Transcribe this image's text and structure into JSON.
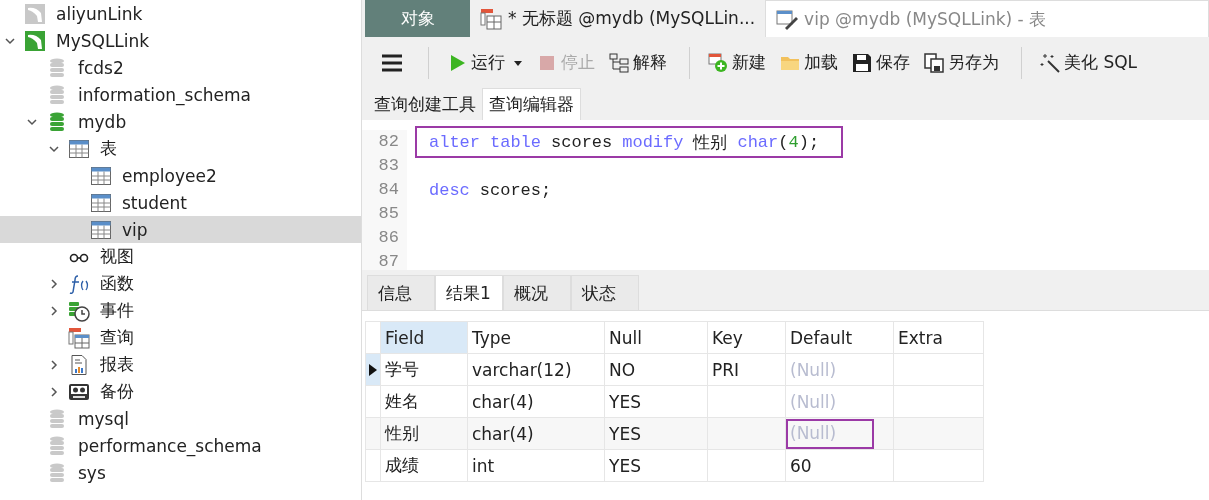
{
  "sidebar": {
    "items": [
      {
        "label": "aliyunLink",
        "kind": "connection",
        "open": false
      },
      {
        "label": "MySQLLink",
        "kind": "connection",
        "open": true,
        "expanded": true,
        "children": [
          {
            "label": "fcds2",
            "kind": "database",
            "open": false
          },
          {
            "label": "information_schema",
            "kind": "database",
            "open": false
          },
          {
            "label": "mydb",
            "kind": "database",
            "open": true,
            "expanded": true,
            "children": [
              {
                "label": "表",
                "kind": "tables",
                "expanded": true,
                "children": [
                  {
                    "label": "employee2",
                    "kind": "table",
                    "selected": false
                  },
                  {
                    "label": "student",
                    "kind": "table",
                    "selected": false
                  },
                  {
                    "label": "vip",
                    "kind": "table",
                    "selected": true
                  }
                ]
              },
              {
                "label": "视图",
                "kind": "views"
              },
              {
                "label": "函数",
                "kind": "functions",
                "expanded": false
              },
              {
                "label": "事件",
                "kind": "events",
                "expanded": false
              },
              {
                "label": "查询",
                "kind": "queries"
              },
              {
                "label": "报表",
                "kind": "reports",
                "expanded": false
              },
              {
                "label": "备份",
                "kind": "backups",
                "expanded": false
              }
            ]
          },
          {
            "label": "mysql",
            "kind": "database",
            "open": false
          },
          {
            "label": "performance_schema",
            "kind": "database",
            "open": false
          },
          {
            "label": "sys",
            "kind": "database",
            "open": false
          }
        ]
      }
    ]
  },
  "tabs": [
    {
      "label": "对象",
      "kind": "objects",
      "selected": false
    },
    {
      "label": "* 无标题 @mydb (MySQLLin...",
      "kind": "query",
      "selected": true
    },
    {
      "label": "vip @mydb (MySQLLink) - 表",
      "kind": "table",
      "selected": false
    }
  ],
  "toolbar": [
    {
      "kind": "menu"
    },
    {
      "kind": "separator"
    },
    {
      "label": "运行",
      "kind": "run",
      "dropdown": true,
      "disabled": false
    },
    {
      "label": "停止",
      "kind": "stop",
      "disabled": true
    },
    {
      "label": "解释",
      "kind": "explain",
      "disabled": false
    },
    {
      "kind": "separator"
    },
    {
      "label": "新建",
      "kind": "new",
      "disabled": false
    },
    {
      "label": "加载",
      "kind": "load",
      "disabled": false
    },
    {
      "label": "保存",
      "kind": "save",
      "disabled": false
    },
    {
      "label": "另存为",
      "kind": "save-as",
      "disabled": false
    },
    {
      "kind": "separator"
    },
    {
      "label": "美化 SQL",
      "kind": "beautify",
      "disabled": false
    }
  ],
  "editor_tabs": [
    {
      "label": "查询创建工具",
      "selected": false
    },
    {
      "label": "查询编辑器",
      "selected": true
    }
  ],
  "editor": {
    "lines": [
      {
        "number": "82",
        "boxed": true,
        "tokens": [
          {
            "text": "alter",
            "kind": "keyword"
          },
          {
            "text": "table",
            "kind": "keyword"
          },
          {
            "text": "scores",
            "kind": "plain"
          },
          {
            "text": "modify",
            "kind": "keyword"
          },
          {
            "text": "性别",
            "kind": "plain"
          },
          {
            "parts": [
              {
                "text": "char",
                "kind": "keyword"
              },
              {
                "text": "(",
                "kind": "plain"
              },
              {
                "text": "4",
                "kind": "number"
              },
              {
                "text": ");",
                "kind": "plain"
              }
            ]
          }
        ]
      },
      {
        "number": "83"
      },
      {
        "number": "84",
        "boxed": false,
        "tokens": [
          {
            "text": "desc",
            "kind": "keyword"
          },
          {
            "text": "scores;",
            "kind": "plain"
          }
        ]
      },
      {
        "number": "85"
      },
      {
        "number": "86"
      },
      {
        "number": "87"
      }
    ]
  },
  "result_tabs": [
    {
      "label": "信息",
      "selected": false
    },
    {
      "label": "结果1",
      "selected": true
    },
    {
      "label": "概况",
      "selected": false
    },
    {
      "label": "状态",
      "selected": false
    }
  ],
  "result_table": {
    "columns": [
      "Field",
      "Type",
      "Null",
      "Key",
      "Default",
      "Extra"
    ],
    "rows": [
      {
        "current": true,
        "cells": [
          {
            "text": "学号"
          },
          {
            "text": "varchar(12)"
          },
          {
            "text": "NO"
          },
          {
            "text": "PRI"
          },
          {
            "text": "(Null)",
            "null": true
          },
          null
        ]
      },
      {
        "current": false,
        "cells": [
          {
            "text": "姓名"
          },
          {
            "text": "char(4)"
          },
          {
            "text": "YES"
          },
          null,
          {
            "text": "(Null)",
            "null": true
          },
          null
        ]
      },
      {
        "current": false,
        "cells": [
          {
            "text": "性别"
          },
          {
            "text": "char(4)"
          },
          {
            "text": "YES"
          },
          null,
          {
            "text": "(Null)",
            "null": true,
            "boxed": true
          },
          null
        ]
      },
      {
        "current": false,
        "cells": [
          {
            "text": "成绩"
          },
          {
            "text": "int"
          },
          {
            "text": "YES"
          },
          null,
          {
            "text": "60",
            "null": false
          },
          null
        ]
      }
    ]
  }
}
